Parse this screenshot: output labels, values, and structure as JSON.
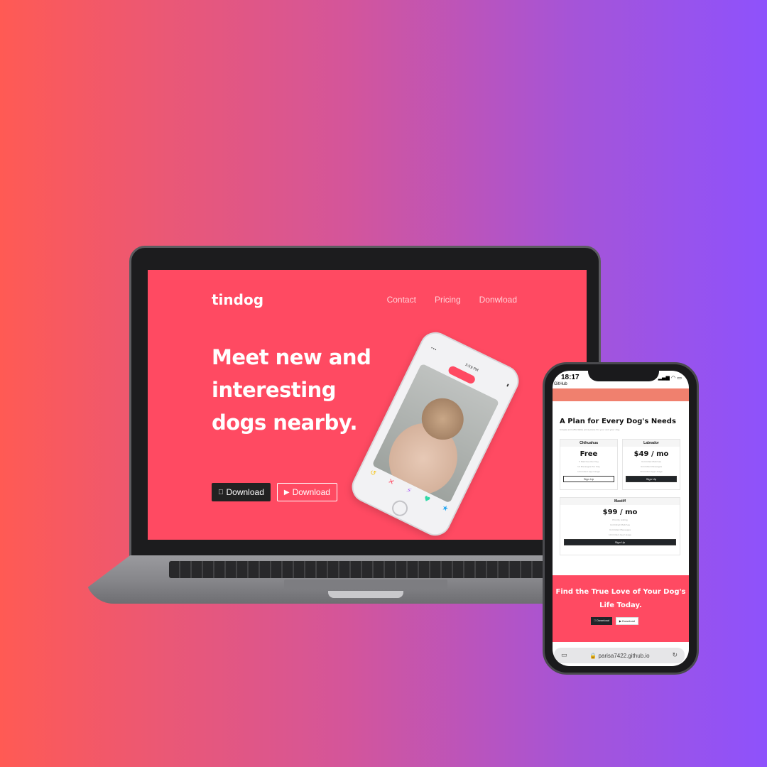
{
  "laptop": {
    "brand": "tindog",
    "nav": [
      "Contact",
      "Pricing",
      "Donwload"
    ],
    "hero_title": "Meet new and interesting dogs nearby.",
    "buttons": {
      "apple": "Download",
      "play": "Download"
    },
    "tilted_phone": {
      "time": "3:59 PM"
    }
  },
  "phone": {
    "status_time": "18:17",
    "status_app": "GitHub",
    "plans_title": "A Plan for Every Dog's Needs",
    "plans_subtitle": "Simple and affordable price plans for your and your dog.",
    "cards": [
      {
        "name": "Chihuahua",
        "price": "Free",
        "features": [
          "5 Matches Per Day",
          "10 Messages Per Day",
          "Unlimited App Usage"
        ],
        "cta": "Sign Up"
      },
      {
        "name": "Labrador",
        "price": "$49 / mo",
        "features": [
          "Unlimited Matches",
          "Unlimited Messages",
          "Unlimited App Usage"
        ],
        "cta": "Sign Up"
      },
      {
        "name": "Mastiff",
        "price": "$99 / mo",
        "features": [
          "Pirority Listing",
          "Unlimited Matches",
          "Unlimited Messages",
          "Unlimited App Usage"
        ],
        "cta": "Sign Up"
      }
    ],
    "cta_title": "Find the True Love of Your Dog's Life Today.",
    "cta_buttons": [
      "Download",
      "Download"
    ],
    "url": "parisa7422.github.io"
  },
  "colors": {
    "brand_pink": "#ff4a62",
    "coral": "#f0806e",
    "dark_button": "#212529"
  }
}
